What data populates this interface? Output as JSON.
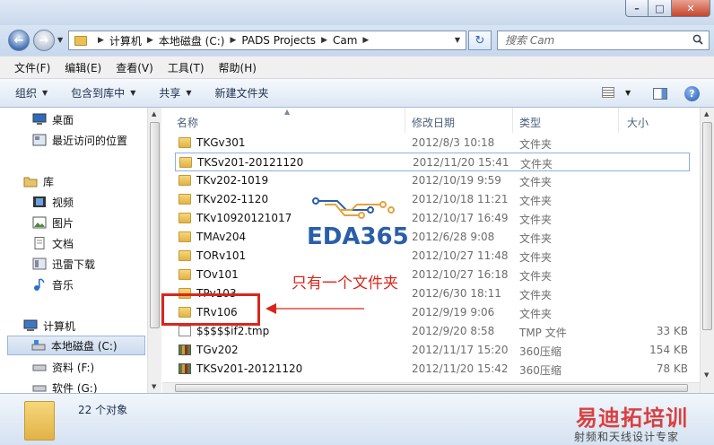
{
  "window": {
    "min_glyph": "–",
    "max_glyph": "□",
    "close_glyph": "✕"
  },
  "address": {
    "crumbs": [
      "计算机",
      "本地磁盘 (C:)",
      "PADS Projects",
      "Cam"
    ],
    "search_placeholder": "搜索 Cam"
  },
  "menu": [
    "文件(F)",
    "编辑(E)",
    "查看(V)",
    "工具(T)",
    "帮助(H)"
  ],
  "commands": {
    "organize": "组织",
    "include_library": "包含到库中",
    "share": "共享",
    "new_folder": "新建文件夹",
    "help": "?"
  },
  "nav": {
    "items": [
      {
        "label": "桌面",
        "icon": "desktop-icon"
      },
      {
        "label": "最近访问的位置",
        "icon": "recent-places-icon"
      },
      {
        "label": "库",
        "icon": "library-icon"
      },
      {
        "label": "视频",
        "icon": "video-icon"
      },
      {
        "label": "图片",
        "icon": "pictures-icon"
      },
      {
        "label": "文档",
        "icon": "documents-icon"
      },
      {
        "label": "迅雷下载",
        "icon": "download-icon"
      },
      {
        "label": "音乐",
        "icon": "music-icon"
      },
      {
        "label": "计算机",
        "icon": "computer-icon"
      },
      {
        "label": "本地磁盘 (C:)",
        "icon": "drive-icon"
      },
      {
        "label": "资料 (F:)",
        "icon": "drive-icon"
      },
      {
        "label": "软件 (G:)",
        "icon": "drive-icon"
      }
    ]
  },
  "columns": {
    "name": "名称",
    "modified": "修改日期",
    "type": "类型",
    "size": "大小"
  },
  "files": [
    {
      "name": "TKGv301",
      "date": "2012/8/3 10:18",
      "type": "文件夹",
      "size": "",
      "kind": "folder"
    },
    {
      "name": "TKSv201-20121120",
      "date": "2012/11/20 15:41",
      "type": "文件夹",
      "size": "",
      "kind": "folder"
    },
    {
      "name": "TKv202-1019",
      "date": "2012/10/19 9:59",
      "type": "文件夹",
      "size": "",
      "kind": "folder"
    },
    {
      "name": "TKv202-1120",
      "date": "2012/10/18 11:21",
      "type": "文件夹",
      "size": "",
      "kind": "folder"
    },
    {
      "name": "TKv10920121017",
      "date": "2012/10/17 16:49",
      "type": "文件夹",
      "size": "",
      "kind": "folder"
    },
    {
      "name": "TMAv204",
      "date": "2012/6/28 9:08",
      "type": "文件夹",
      "size": "",
      "kind": "folder"
    },
    {
      "name": "TORv101",
      "date": "2012/10/27 11:48",
      "type": "文件夹",
      "size": "",
      "kind": "folder"
    },
    {
      "name": "TOv101",
      "date": "2012/10/27 16:18",
      "type": "文件夹",
      "size": "",
      "kind": "folder"
    },
    {
      "name": "TPv103",
      "date": "2012/6/30 18:11",
      "type": "文件夹",
      "size": "",
      "kind": "folder"
    },
    {
      "name": "TRv106",
      "date": "2012/9/19 9:06",
      "type": "文件夹",
      "size": "",
      "kind": "folder"
    },
    {
      "name": "$$$$$if2.tmp",
      "date": "2012/9/20 8:58",
      "type": "TMP 文件",
      "size": "33 KB",
      "kind": "tmp"
    },
    {
      "name": "TGv202",
      "date": "2012/11/17 15:20",
      "type": "360压缩",
      "size": "154 KB",
      "kind": "zip"
    },
    {
      "name": "TKSv201-20121120",
      "date": "2012/11/20 15:42",
      "type": "360压缩",
      "size": "78 KB",
      "kind": "zip"
    }
  ],
  "status": {
    "count": "22 个对象"
  },
  "annotation": {
    "text": "只有一个文件夹",
    "color": "#d9261c"
  },
  "watermarks": {
    "eda": "EDA365",
    "brand": "易迪拓培训",
    "brand_sub": "射频和天线设计专家"
  },
  "colors": {
    "accent": "#2a5ea8",
    "annotation": "#d9261c",
    "folder": "#e1b247"
  }
}
